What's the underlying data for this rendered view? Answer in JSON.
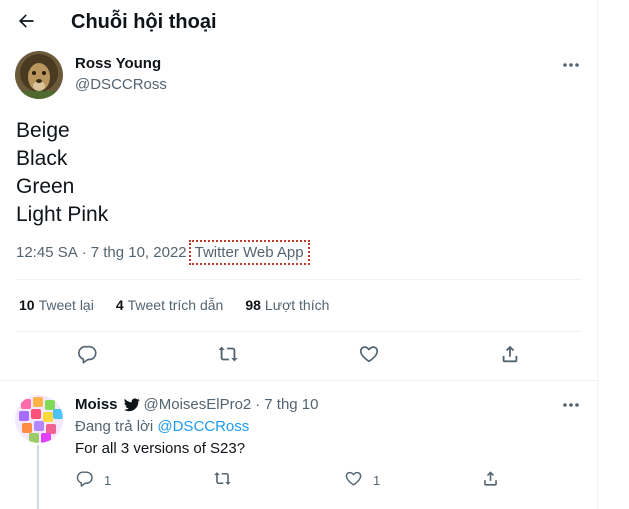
{
  "header": {
    "title": "Chuỗi hội thoại"
  },
  "main_tweet": {
    "author_name": "Ross Young",
    "author_handle": "@DSCCRoss",
    "lines": [
      "Beige",
      "Black",
      "Green",
      "Light Pink"
    ],
    "time": "12:45 SA",
    "separator": "·",
    "date": "7 thg 10, 2022",
    "source": "Twitter Web App",
    "stats": {
      "retweets_count": "10",
      "retweets_label": "Tweet lại",
      "quotes_count": "4",
      "quotes_label": "Tweet trích dẫn",
      "likes_count": "98",
      "likes_label": "Lượt thích"
    }
  },
  "reply_tweet": {
    "author_name": "Moiss",
    "author_handle": "@MoisesElPro2",
    "separator": "·",
    "date": "7 thg 10",
    "replying_prefix": "Đang trả lời",
    "replying_to": "@DSCCRoss",
    "text": "For all 3 versions of S23?",
    "reply_count": "1",
    "like_count": "1"
  },
  "icons": {
    "back": "arrow-left-icon",
    "more": "more-dots-icon",
    "reply": "reply-bubble-icon",
    "retweet": "retweet-icon",
    "like": "heart-icon",
    "share": "share-icon",
    "verified": "twitter-bird-icon"
  },
  "colors": {
    "text": "#0f1419",
    "muted": "#536471",
    "accent": "#1d9bf0",
    "divider": "#eff3f4"
  }
}
